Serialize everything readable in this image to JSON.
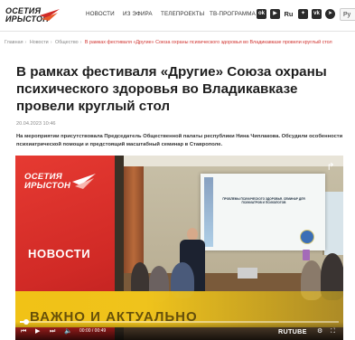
{
  "header": {
    "logo_line1": "ОСЕТИЯ",
    "logo_line2": "ИРЫСТОН",
    "nav": [
      "НОВОСТИ",
      "ИЗ ЭФИРА",
      "ТЕЛЕПРОЕКТЫ",
      "ТВ-ПРОГРАММА"
    ],
    "social_icons": [
      "ok-icon",
      "youtube-icon",
      "rutube-icon",
      "dzen-icon",
      "vk-icon",
      "messenger-icon",
      "telegram-icon"
    ],
    "lang": "Ру"
  },
  "breadcrumb": {
    "items": [
      "Главная",
      "Новости",
      "Общество"
    ],
    "current": "В рамках фестиваля «Другие» Союза охраны психического здоровья во Владикавказе провели круглый стол"
  },
  "article": {
    "title": "В рамках фестиваля «Другие» Союза охраны психического здоровья во Владикавказе провели круглый стол",
    "date": "20.04.2023 10:46",
    "lead": "На мероприятии присутствовала Председатель Общественной палаты республики Нина Чиплакова. Обсудили особенности психиатрической помощи и предстоящий масштабный семинар в Ставрополе."
  },
  "video": {
    "overlay_logo_line1": "ОСЕТИЯ",
    "overlay_logo_line2": "ИРЫСТОН",
    "overlay_label": "НОВОСТИ",
    "ticker": "ВАЖНО И АКТУАЛЬНО",
    "screen_text": "ПРОБЛЕМЫ ПСИХИЧЕСКОГО ЗДОРОВЬЯ. СЕМИНАР ДЛЯ ПСИХИАТРОВ И ПСИХОЛОГОВ",
    "time": "00:00 / 00:49",
    "provider": "RUTUBE",
    "progress": 0.02,
    "colors": {
      "brand_red": "#d12a26",
      "ticker_yellow": "#f1c216"
    }
  }
}
